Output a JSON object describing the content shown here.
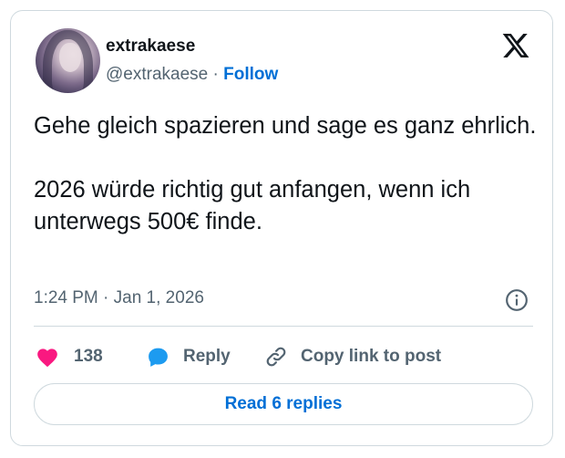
{
  "author": {
    "display_name": "extrakaese",
    "handle": "@extrakaese",
    "separator": "·",
    "follow_label": "Follow"
  },
  "tweet": {
    "line1": "Gehe gleich spazieren und sage es ganz ehrlich.",
    "line2": "2026 würde richtig gut anfangen, wenn ich unterwegs 500€ finde.",
    "timestamp": "1:24 PM · Jan 1, 2026"
  },
  "actions": {
    "like_count": "138",
    "reply_label": "Reply",
    "copy_link_label": "Copy link to post"
  },
  "read_replies_label": "Read 6 replies",
  "colors": {
    "link_blue": "#006fd6",
    "like_pink": "#f91880",
    "reply_blue": "#1d9bf0",
    "muted_text": "#536471",
    "border": "#cfd9de"
  },
  "icons": {
    "brand": "x-logo-icon",
    "info": "info-icon",
    "like": "heart-icon",
    "reply": "speech-bubble-icon",
    "copy_link": "link-icon"
  }
}
